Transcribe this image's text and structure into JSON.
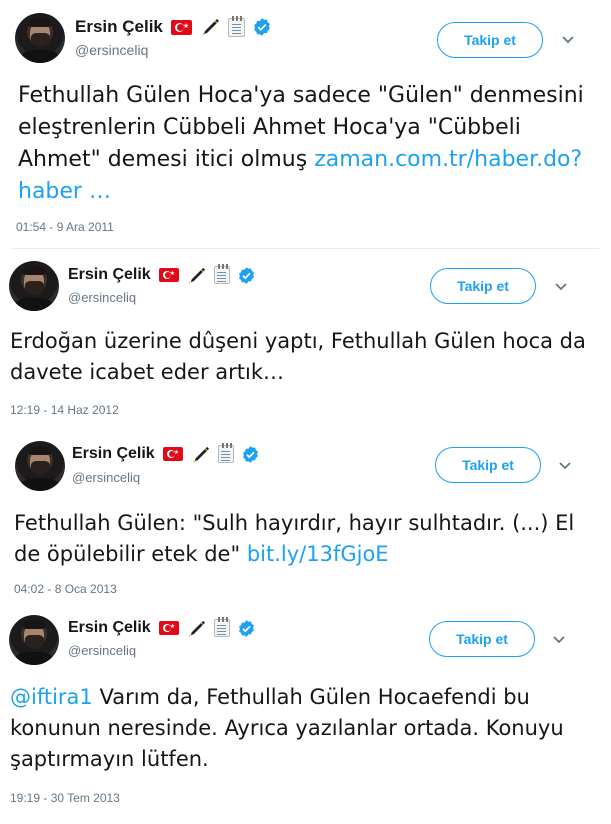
{
  "colors": {
    "accent": "#1da1f2",
    "muted": "#657786",
    "text": "#14171a",
    "flag": "#e30a17"
  },
  "tweets": [
    {
      "name": "Ersin Çelik",
      "handle": "@ersinceliq",
      "follow_label": "Takip et",
      "text": "Fethullah Gülen Hoca'ya sadece \"Gülen\" denmesini eleştrenlerin Cübbeli Ahmet Hoca'ya \"Cübbeli Ahmet\" demesi itici olmuş",
      "link": "zaman.com.tr/haber.do?haber …",
      "timestamp": "01:54 - 9 Ara 2011"
    },
    {
      "name": "Ersin Çelik",
      "handle": "@ersinceliq",
      "follow_label": "Takip et",
      "text": "Erdoğan üzerine dûşeni yaptı, Fethullah Gülen hoca da davete icabet eder artık…",
      "timestamp": "12:19 - 14 Haz 2012"
    },
    {
      "name": "Ersin Çelik",
      "handle": "@ersinceliq",
      "follow_label": "Takip et",
      "text": "Fethullah Gülen: \"Sulh hayırdır, hayır sulhtadır. (...) El de öpülebilir etek de\"",
      "link": "bit.ly/13fGjoE",
      "timestamp": "04:02 - 8 Oca 2013"
    },
    {
      "name": "Ersin Çelik",
      "handle": "@ersinceliq",
      "follow_label": "Takip et",
      "mention": "@iftira1",
      "text": "Varım da, Fethullah Gülen Hocaefendi bu konunun neresinde. Ayrıca yazılanlar ortada. Konuyu şaptırmayın lütfen.",
      "timestamp": "19:19 - 30 Tem 2013"
    }
  ],
  "icons": {
    "flag": "turkey-flag-icon",
    "pen": "fountain-pen-icon",
    "note": "spiral-notepad-icon",
    "verified": "verified-badge-icon",
    "chevron": "chevron-down-icon"
  }
}
